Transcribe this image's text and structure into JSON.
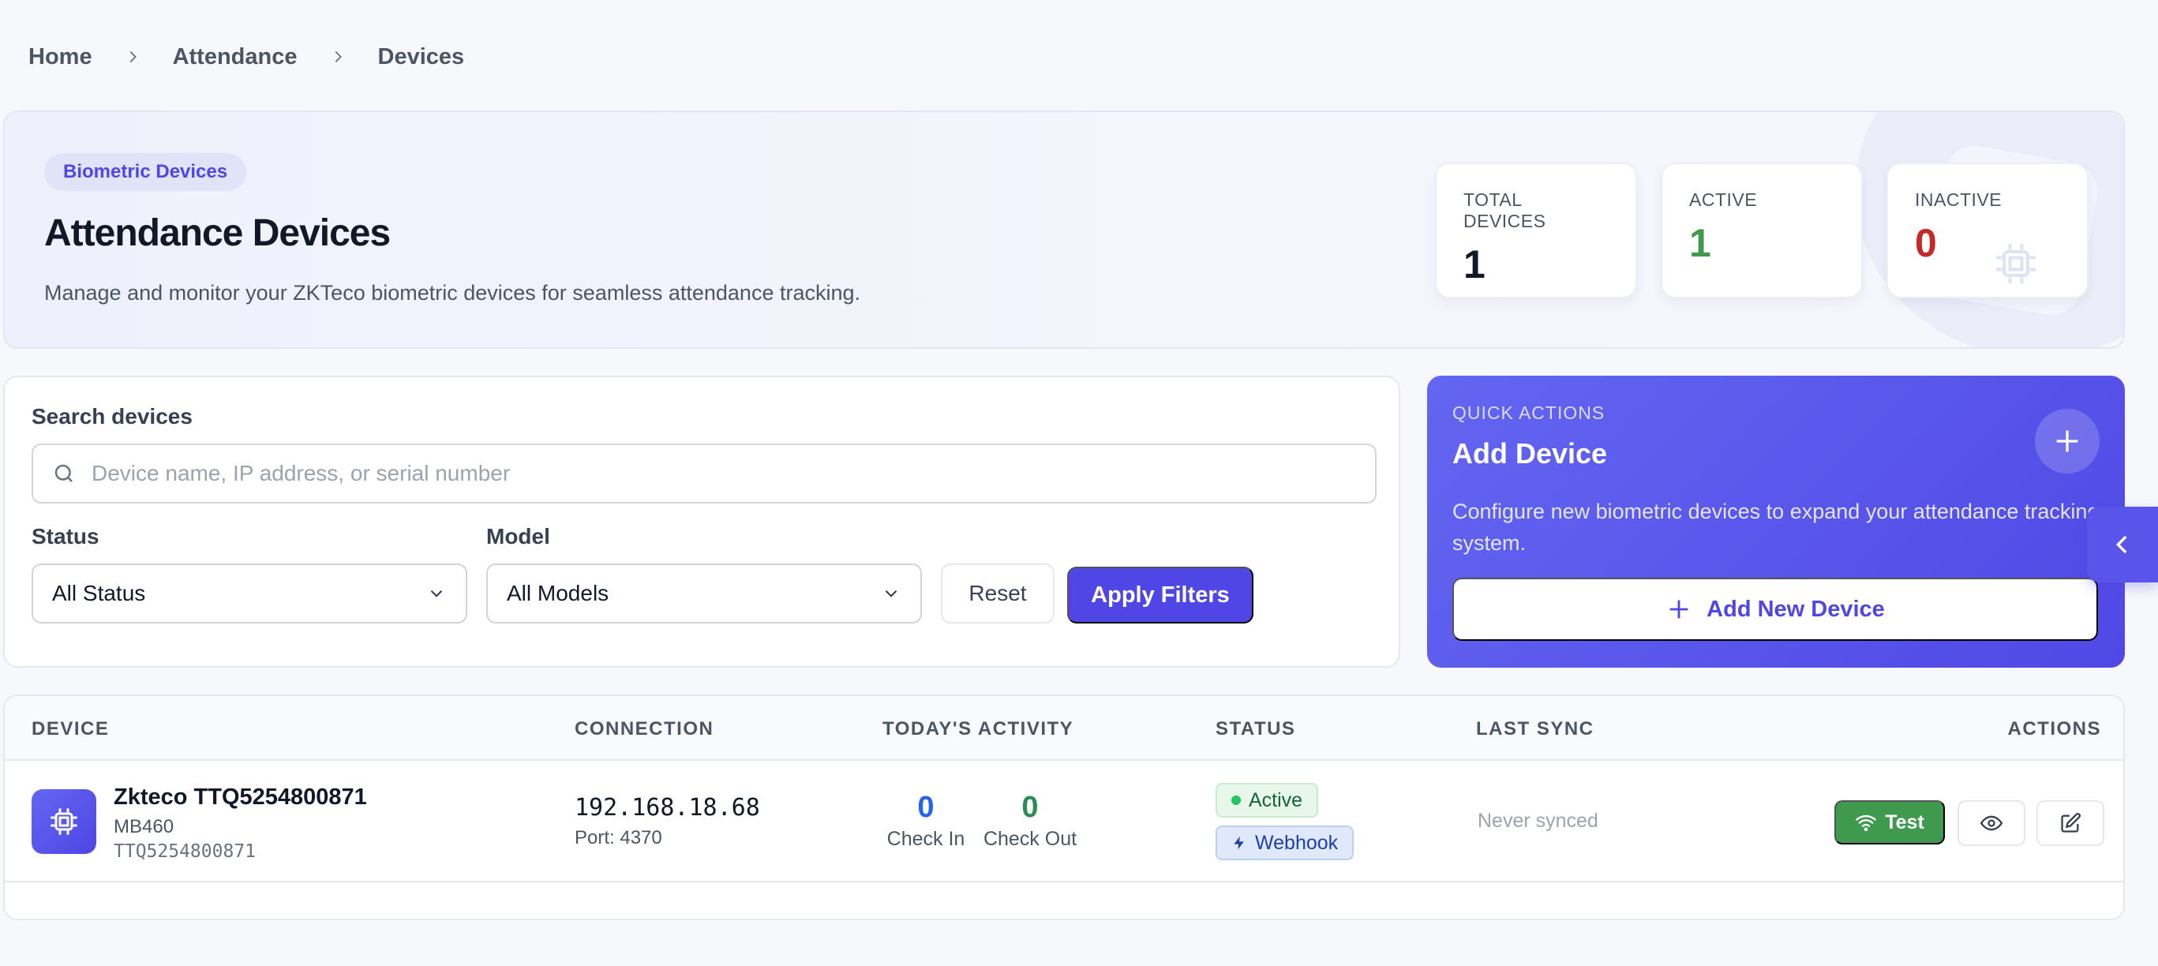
{
  "breadcrumb": {
    "items": [
      "Home",
      "Attendance",
      "Devices"
    ]
  },
  "hero": {
    "badge": "Biometric Devices",
    "title": "Attendance Devices",
    "subtitle": "Manage and monitor your ZKTeco biometric devices for seamless attendance tracking."
  },
  "stats": [
    {
      "label": "TOTAL DEVICES",
      "value": "1",
      "color": "#111827"
    },
    {
      "label": "ACTIVE",
      "value": "1",
      "color": "#3f9a4e"
    },
    {
      "label": "INACTIVE",
      "value": "0",
      "color": "#c62828"
    }
  ],
  "filters": {
    "search_label": "Search devices",
    "search_placeholder": "Device name, IP address, or serial number",
    "search_value": "",
    "status_label": "Status",
    "status_selected": "All Status",
    "model_label": "Model",
    "model_selected": "All Models",
    "reset_label": "Reset",
    "apply_label": "Apply Filters"
  },
  "quick_actions": {
    "kicker": "QUICK ACTIONS",
    "title": "Add Device",
    "description": "Configure new biometric devices to expand your attendance tracking system.",
    "button_label": "Add New Device"
  },
  "table": {
    "headers": [
      "DEVICE",
      "CONNECTION",
      "TODAY'S ACTIVITY",
      "STATUS",
      "LAST SYNC",
      "ACTIONS"
    ],
    "rows": [
      {
        "name": "Zkteco TTQ5254800871",
        "model": "MB460",
        "serial": "TTQ5254800871",
        "ip": "192.168.18.68",
        "port": "Port: 4370",
        "check_in": "0",
        "check_in_label": "Check In",
        "check_out": "0",
        "check_out_label": "Check Out",
        "status": "Active",
        "mode": "Webhook",
        "last_sync": "Never synced",
        "test_label": "Test"
      }
    ]
  },
  "colors": {
    "accent": "#4f46e5",
    "success": "#3f9a4e",
    "danger": "#c62828",
    "check_in": "#2563eb",
    "check_out": "#2e8b57"
  }
}
